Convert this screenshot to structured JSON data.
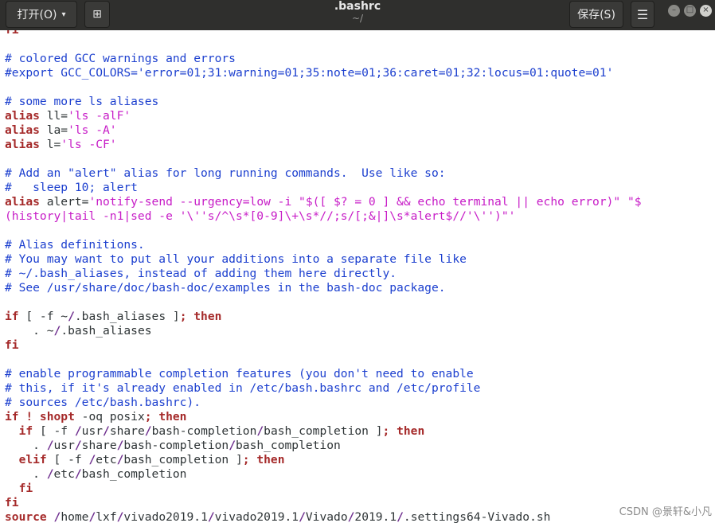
{
  "header": {
    "open_label": "打开(O)",
    "open_caret": "▾",
    "new_doc_icon": "⊞",
    "title": ".bashrc",
    "subtitle": "~/",
    "save_label": "保存(S)",
    "menu_icon": "☰",
    "window_controls": {
      "minimize": "–",
      "maximize": "□",
      "close": "×"
    }
  },
  "colors": {
    "comment": "#1d40cf",
    "keyword": "#a52a2a",
    "string": "#c71cc7",
    "path_slash": "#6f2f8f",
    "text": "#2e3436",
    "titlebar": "#2f2f2d"
  },
  "editor": {
    "lines": [
      [
        [
          "k",
          "fi"
        ]
      ],
      [],
      [
        [
          "c",
          "# colored GCC warnings and errors"
        ]
      ],
      [
        [
          "c",
          "#export GCC_COLORS='error=01;31:warning=01;35:note=01;36:caret=01;32:locus=01:quote=01'"
        ]
      ],
      [],
      [
        [
          "c",
          "# some more ls aliases"
        ]
      ],
      [
        [
          "k",
          "alias"
        ],
        [
          "t",
          " ll="
        ],
        [
          "s",
          "'ls -alF'"
        ]
      ],
      [
        [
          "k",
          "alias"
        ],
        [
          "t",
          " la="
        ],
        [
          "s",
          "'ls -A'"
        ]
      ],
      [
        [
          "k",
          "alias"
        ],
        [
          "t",
          " l="
        ],
        [
          "s",
          "'ls -CF'"
        ]
      ],
      [],
      [
        [
          "c",
          "# Add an \"alert\" alias for long running commands.  Use like so:"
        ]
      ],
      [
        [
          "c",
          "#   sleep 10; alert"
        ]
      ],
      [
        [
          "k",
          "alias"
        ],
        [
          "t",
          " alert="
        ],
        [
          "s",
          "'notify-send --urgency=low -i \"$([ $? = 0 ] && echo terminal || echo error)\" \"$"
        ]
      ],
      [
        [
          "s",
          "(history|tail -n1|sed -e '\\''s/^\\s*[0-9]\\+\\s*//;s/[;&|]\\s*alert$//'\\'')\"'"
        ]
      ],
      [],
      [
        [
          "c",
          "# Alias definitions."
        ]
      ],
      [
        [
          "c",
          "# You may want to put all your additions into a separate file like"
        ]
      ],
      [
        [
          "c",
          "# ~/.bash_aliases, instead of adding them here directly."
        ]
      ],
      [
        [
          "c",
          "# See /usr/share/doc/bash-doc/examples in the bash-doc package."
        ]
      ],
      [],
      [
        [
          "k",
          "if"
        ],
        [
          "t",
          " [ -f ~"
        ],
        [
          "p",
          "/"
        ],
        [
          "t",
          ".bash_aliases ]"
        ],
        [
          "k",
          "; then"
        ]
      ],
      [
        [
          "t",
          "    . ~"
        ],
        [
          "p",
          "/"
        ],
        [
          "t",
          ".bash_aliases"
        ]
      ],
      [
        [
          "k",
          "fi"
        ]
      ],
      [],
      [
        [
          "c",
          "# enable programmable completion features (you don't need to enable"
        ]
      ],
      [
        [
          "c",
          "# this, if it's already enabled in /etc/bash.bashrc and /etc/profile"
        ]
      ],
      [
        [
          "c",
          "# sources /etc/bash.bashrc)."
        ]
      ],
      [
        [
          "k",
          "if ! shopt"
        ],
        [
          "t",
          " -oq posix"
        ],
        [
          "k",
          "; then"
        ]
      ],
      [
        [
          "t",
          "  "
        ],
        [
          "k",
          "if"
        ],
        [
          "t",
          " [ -f "
        ],
        [
          "p",
          "/"
        ],
        [
          "t",
          "usr"
        ],
        [
          "p",
          "/"
        ],
        [
          "t",
          "share"
        ],
        [
          "p",
          "/"
        ],
        [
          "t",
          "bash-completion"
        ],
        [
          "p",
          "/"
        ],
        [
          "t",
          "bash_completion ]"
        ],
        [
          "k",
          "; then"
        ]
      ],
      [
        [
          "t",
          "    . "
        ],
        [
          "p",
          "/"
        ],
        [
          "t",
          "usr"
        ],
        [
          "p",
          "/"
        ],
        [
          "t",
          "share"
        ],
        [
          "p",
          "/"
        ],
        [
          "t",
          "bash-completion"
        ],
        [
          "p",
          "/"
        ],
        [
          "t",
          "bash_completion"
        ]
      ],
      [
        [
          "t",
          "  "
        ],
        [
          "k",
          "elif"
        ],
        [
          "t",
          " [ -f "
        ],
        [
          "p",
          "/"
        ],
        [
          "t",
          "etc"
        ],
        [
          "p",
          "/"
        ],
        [
          "t",
          "bash_completion ]"
        ],
        [
          "k",
          "; then"
        ]
      ],
      [
        [
          "t",
          "    . "
        ],
        [
          "p",
          "/"
        ],
        [
          "t",
          "etc"
        ],
        [
          "p",
          "/"
        ],
        [
          "t",
          "bash_completion"
        ]
      ],
      [
        [
          "t",
          "  "
        ],
        [
          "k",
          "fi"
        ]
      ],
      [
        [
          "k",
          "fi"
        ]
      ],
      [
        [
          "k",
          "source"
        ],
        [
          "t",
          " "
        ],
        [
          "p",
          "/"
        ],
        [
          "t",
          "home"
        ],
        [
          "p",
          "/"
        ],
        [
          "t",
          "lxf"
        ],
        [
          "p",
          "/"
        ],
        [
          "t",
          "vivado2019.1"
        ],
        [
          "p",
          "/"
        ],
        [
          "t",
          "vivado2019.1"
        ],
        [
          "p",
          "/"
        ],
        [
          "t",
          "Vivado"
        ],
        [
          "p",
          "/"
        ],
        [
          "t",
          "2019.1"
        ],
        [
          "p",
          "/"
        ],
        [
          "t",
          ".settings64-Vivado.sh"
        ]
      ]
    ]
  },
  "watermark": "CSDN @景轩&小凡"
}
